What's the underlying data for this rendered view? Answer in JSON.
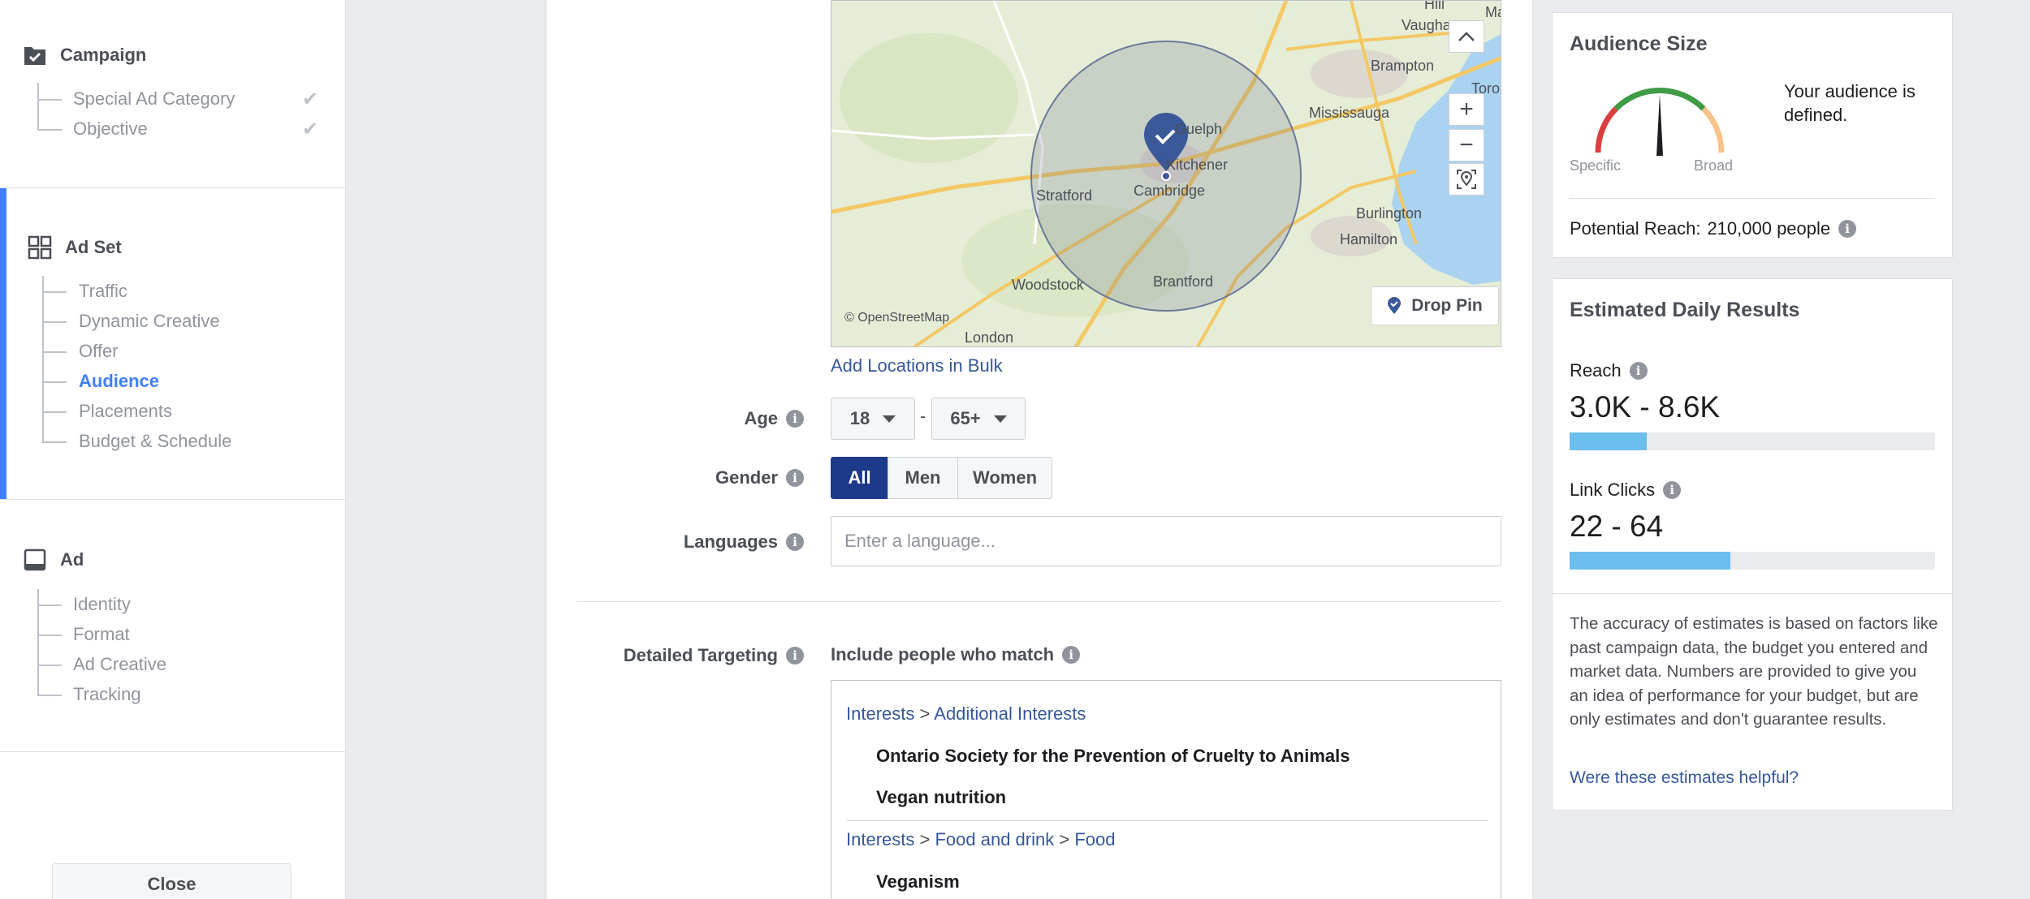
{
  "sidebar": {
    "campaign": {
      "title": "Campaign",
      "items": [
        "Special Ad Category",
        "Objective"
      ]
    },
    "ad_set": {
      "title": "Ad Set",
      "items": [
        "Traffic",
        "Dynamic Creative",
        "Offer",
        "Audience",
        "Placements",
        "Budget & Schedule"
      ],
      "current": "Audience"
    },
    "ad": {
      "title": "Ad",
      "items": [
        "Identity",
        "Format",
        "Ad Creative",
        "Tracking"
      ]
    },
    "close_label": "Close"
  },
  "map": {
    "labels": {
      "vaughan": "Vaughan",
      "hill": "Hill",
      "ma": "Ma",
      "brampton": "Brampton",
      "toro": "Toro",
      "mississauga": "Mississauga",
      "guelph": "Guelph",
      "kitchener": "Kitchener",
      "stratford": "Stratford",
      "cambridge": "Cambridge",
      "burlington": "Burlington",
      "hamilton": "Hamilton",
      "woodstock": "Woodstock",
      "brantford": "Brantford",
      "london": "London"
    },
    "attribution": "© OpenStreetMap",
    "drop_pin_label": "Drop Pin"
  },
  "form": {
    "add_locations_bulk": "Add Locations in Bulk",
    "age_label": "Age",
    "age_min": "18",
    "age_separator": "-",
    "age_max": "65+",
    "gender_label": "Gender",
    "gender_options": [
      "All",
      "Men",
      "Women"
    ],
    "gender_selected": "All",
    "languages_label": "Languages",
    "languages_value": "",
    "languages_placeholder": "Enter a language...",
    "detailed_targeting_label": "Detailed Targeting",
    "include_label": "Include people who match",
    "targeting": {
      "group1": {
        "path": [
          "Interests",
          "Additional Interests"
        ],
        "separator": ">",
        "items": [
          "Ontario Society for the Prevention of Cruelty to Animals",
          "Vegan nutrition"
        ]
      },
      "group2": {
        "path": [
          "Interests",
          "Food and drink",
          "Food"
        ],
        "separator": ">",
        "items": [
          "Veganism"
        ]
      }
    }
  },
  "audience_size": {
    "title": "Audience Size",
    "specific_label": "Specific",
    "broad_label": "Broad",
    "status_text": "Your audience is defined.",
    "potential_reach_label": "Potential Reach:",
    "potential_reach_value": "210,000 people"
  },
  "daily_results": {
    "title": "Estimated Daily Results",
    "reach_label": "Reach",
    "reach_value": "3.0K - 8.6K",
    "reach_fill_fraction": 0.21,
    "link_clicks_label": "Link Clicks",
    "link_clicks_value": "22 - 64",
    "link_clicks_fill_fraction": 0.44,
    "disclaimer": "The accuracy of estimates is based on factors like past campaign data, the budget you entered and market data. Numbers are provided to give you an idea of performance for your budget, but are only estimates and don't guarantee results.",
    "feedback_link": "Were these estimates helpful?"
  },
  "colors": {
    "accent_blue": "#4080ff",
    "selected_segment": "#1d3a8a",
    "bar_fill": "#6bbdec",
    "link": "#365899"
  }
}
